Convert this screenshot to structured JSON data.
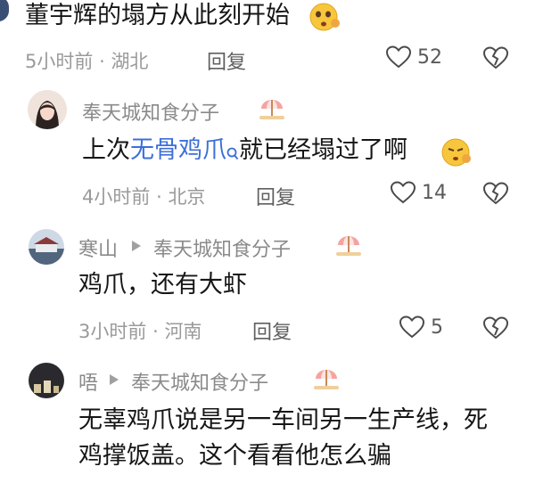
{
  "comments": [
    {
      "text": "董宇辉的塌方从此刻开始",
      "time": "5小时前",
      "location": "湖北",
      "reply_label": "回复",
      "likes": "52"
    },
    {
      "username": "奉天城知食分子",
      "text_before": "上次",
      "link_text": "无骨鸡爪",
      "text_after": "就已经塌过了啊",
      "time": "4小时前",
      "location": "北京",
      "reply_label": "回复",
      "likes": "14"
    },
    {
      "username": "寒山",
      "reply_to": "奉天城知食分子",
      "text": "鸡爪，还有大虾",
      "time": "3小时前",
      "location": "河南",
      "reply_label": "回复",
      "likes": "5"
    },
    {
      "username": "唔",
      "reply_to": "奉天城知食分子",
      "text_line1": "无辜鸡爪说是另一车间另一生产线，死",
      "text_line2": "鸡撑饭盖。这个看看他怎么骗"
    }
  ],
  "separator": "·",
  "colors": {
    "link": "#3d6fd8",
    "meta": "#9a9a9a",
    "emoji": "#f7c63c"
  },
  "icons": [
    "heart-icon",
    "dislike-heart-icon",
    "search-icon",
    "reply-arrow-icon",
    "umbrella-beach-icon",
    "emoji-face-icon"
  ]
}
